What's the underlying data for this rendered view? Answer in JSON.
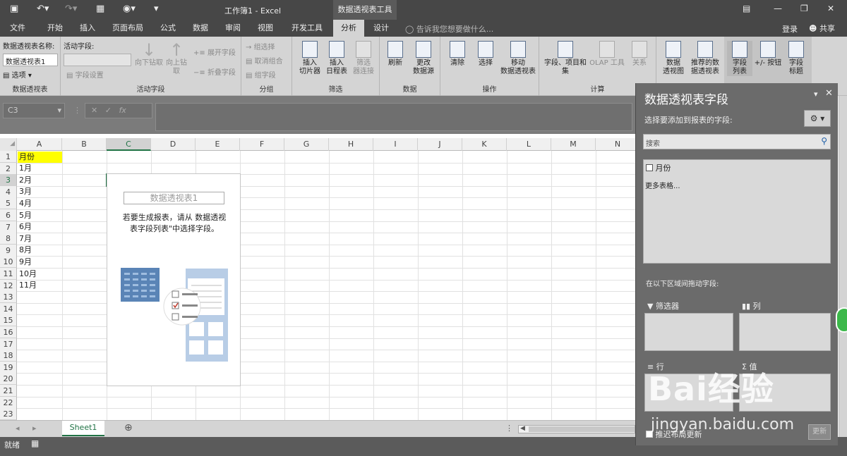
{
  "titlebar": {
    "title": "工作簿1 - Excel",
    "context_tool": "数据透视表工具"
  },
  "tabs": [
    "文件",
    "开始",
    "插入",
    "页面布局",
    "公式",
    "数据",
    "审阅",
    "视图",
    "开发工具",
    "分析",
    "设计"
  ],
  "tell_me": "告诉我您想要做什么...",
  "login": "登录",
  "share": "共享",
  "ribbon": {
    "pivot_name_label": "数据透视表名称:",
    "pivot_name_value": "数据透视表1",
    "options_label": "选项",
    "group_pivot": "数据透视表",
    "active_field_label": "活动字段:",
    "field_settings": "字段设置",
    "drill_down": "向下钻取",
    "drill_up": "向上钻",
    "drill_up2": "取",
    "expand_field": "展开字段",
    "collapse_field": "折叠字段",
    "group_active": "活动字段",
    "group_selection": "组选择",
    "ungroup": "取消组合",
    "group_field": "组字段",
    "group_group": "分组",
    "insert_slicer": "插入\n切片器",
    "insert_timeline": "插入\n日程表",
    "filter_conn": "筛选\n器连接",
    "group_filter": "筛选",
    "refresh": "刷新",
    "change_source": "更改\n数据源",
    "group_data": "数据",
    "clear": "清除",
    "select": "选择",
    "move_pivot": "移动\n数据透视表",
    "group_actions": "操作",
    "fields_items": "字段、项目和\n集",
    "olap": "OLAP 工具",
    "relations": "关系",
    "group_calc": "计算",
    "pivot_chart": "数据\n透视图",
    "recommended": "推荐的数\n据透视表",
    "field_list": "字段\n列表",
    "plus_minus": "+/- 按钮",
    "field_headers": "字段\n标题"
  },
  "namebox": "C3",
  "columns": [
    "A",
    "B",
    "C",
    "D",
    "E",
    "F",
    "G",
    "H",
    "I",
    "J",
    "K",
    "L",
    "M",
    "N"
  ],
  "rows": [
    "1",
    "2",
    "3",
    "4",
    "5",
    "6",
    "7",
    "8",
    "9",
    "10",
    "11",
    "12",
    "13",
    "14",
    "15",
    "16",
    "17",
    "18",
    "19",
    "20",
    "21",
    "22",
    "23"
  ],
  "column_a_values": [
    "月份",
    "1月",
    "2月",
    "3月",
    "4月",
    "5月",
    "6月",
    "7月",
    "8月",
    "9月",
    "10月",
    "11月"
  ],
  "pivot_placeholder": {
    "name": "数据透视表1",
    "instruction_line1": "若要生成报表，请从 数据透视",
    "instruction_line2": "表字段列表\"中选择字段。"
  },
  "sheet_tab": "Sheet1",
  "status": "就绪",
  "panel": {
    "title": "数据透视表字段",
    "choose_fields": "选择要添加到报表的字段:",
    "search_placeholder": "搜索",
    "field_month": "月份",
    "more_tables": "更多表格...",
    "drag_prompt": "在以下区域间拖动字段:",
    "zone_filter": "筛选器",
    "zone_columns": "列",
    "zone_rows": "行",
    "zone_values": "值",
    "defer_update": "推迟布局更新",
    "update_btn": "更新"
  },
  "watermark": {
    "brand": "Bai经验",
    "url": "jingyan.baidu.com"
  },
  "colors": {
    "excel_green": "#217346",
    "highlight_yellow": "#ffff00",
    "dark_chrome": "#474747",
    "panel_bg": "#6b6b6b"
  }
}
